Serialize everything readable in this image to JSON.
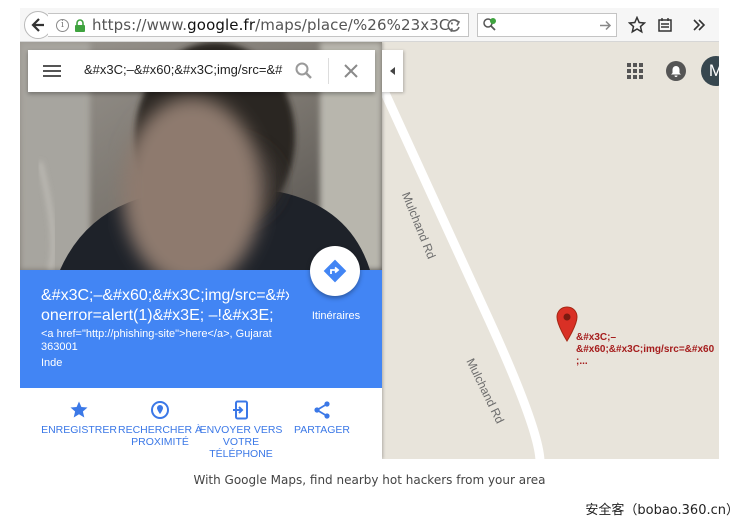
{
  "browser": {
    "url_prefix": "https://www.",
    "url_domain": "google.fr",
    "url_rest": "/maps/place/%26%23x3C;"
  },
  "searchbar": {
    "query": "&#x3C;–&#x60;&#x3C;img/src=&#"
  },
  "place": {
    "title_line1": "&#x3C;–&#x60;&#x3C;img/src=&#x",
    "title_line2": "onerror=alert(1)&#x3E; –!&#x3E;",
    "address": "<a href=\"http://phishing-site\">here</a>, Gujarat 363001",
    "country": "Inde",
    "directions_label": "Itinéraires"
  },
  "actions": [
    {
      "label": "Enregistrer",
      "icon": "star-icon"
    },
    {
      "label": "Rechercher à proximité",
      "icon": "nearby-icon"
    },
    {
      "label": "Envoyer vers votre téléphone",
      "icon": "send-to-phone-icon"
    },
    {
      "label": "Partager",
      "icon": "share-icon"
    }
  ],
  "map": {
    "road_label_1": "Mulchand Rd",
    "road_label_2": "Mulchand Rd",
    "marker_label": "&#x3C;–&#x60;&#x3C;img/src=&#x60 ;...",
    "account_initial": "M"
  },
  "caption": "With Google Maps, find nearby hot hackers from your area",
  "watermark": "安全客（bobao.360.cn）",
  "colors": {
    "place_header": "#4285f4",
    "action_blue": "#3b78e7",
    "marker_red": "#d93025",
    "map_bg": "#e8e4db"
  }
}
